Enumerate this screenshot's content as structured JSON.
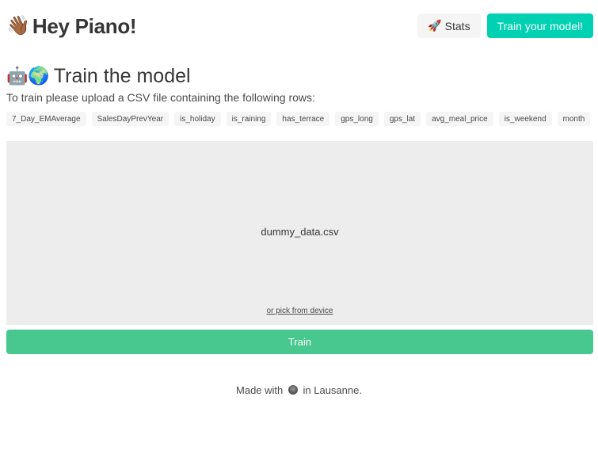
{
  "header": {
    "wave_emoji": "👋🏾",
    "title": "Hey Piano!",
    "stats_icon": "🚀",
    "stats_label": "Stats",
    "train_model_label": "Train your model!"
  },
  "main": {
    "section_emoji": "🤖🌍",
    "section_title": "Train the model",
    "intro": "To train please upload a CSV file containing the following rows:",
    "columns": [
      "7_Day_EMAverage",
      "SalesDayPrevYear",
      "is_holiday",
      "is_raining",
      "has_terrace",
      "gps_long",
      "gps_lat",
      "avg_meal_price",
      "is_weekend",
      "month"
    ],
    "dropzone": {
      "file_name": "dummy_data.csv",
      "pick_label": "or pick from device"
    },
    "train_button": "Train"
  },
  "footer": {
    "prefix": "Made with",
    "suffix": "in Lausanne."
  },
  "colors": {
    "primary": "#00d1b2",
    "success": "#48c78e",
    "light": "#f5f5f5"
  }
}
